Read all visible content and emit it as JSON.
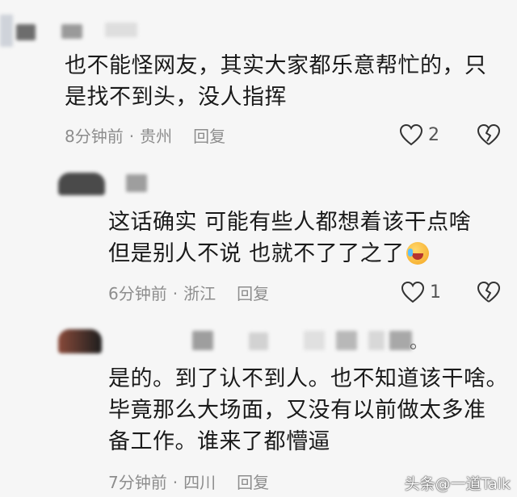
{
  "comments": [
    {
      "lines": [
        "也不能怪网友，其实大家都乐意帮忙的，只",
        "是找不到头，没人指挥"
      ],
      "time": "8分钟前",
      "location": "贵州",
      "reply_label": "回复",
      "likes": "2"
    },
    {
      "lines": [
        "这话确实  可能有些人都想着该干点啥",
        "但是别人不说  也就不了了之了"
      ],
      "time": "6分钟前",
      "location": "浙江",
      "reply_label": "回复",
      "likes": "1"
    },
    {
      "lines": [
        "是的。到了认不到人。也不知道该干啥。",
        "毕竟那么大场面，又没有以前做太多准",
        "备工作。谁来了都懵逼"
      ],
      "time": "7分钟前",
      "location": "四川",
      "reply_label": "回复"
    }
  ],
  "separator": "·",
  "watermark": "头条@一道Talk"
}
